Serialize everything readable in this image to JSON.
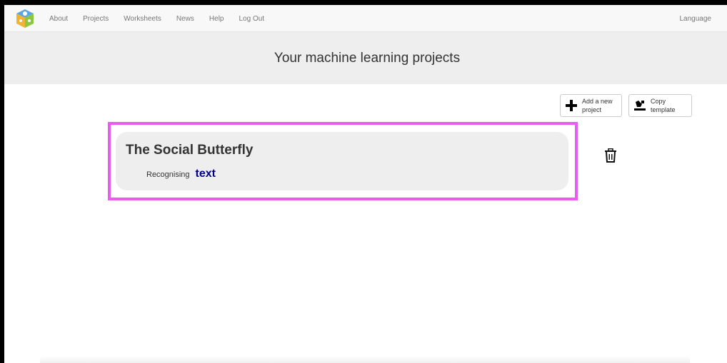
{
  "nav": {
    "links": [
      "About",
      "Projects",
      "Worksheets",
      "News",
      "Help",
      "Log Out"
    ],
    "language": "Language"
  },
  "header": {
    "title": "Your machine learning projects"
  },
  "actions": {
    "add_line1": "Add a new",
    "add_line2": "project",
    "copy_line1": "Copy",
    "copy_line2": "template"
  },
  "project": {
    "name": "The Social Butterfly",
    "type_label": "Recognising",
    "type_value": "text"
  },
  "colors": {
    "highlight": "#e85cf0",
    "type_value": "#00008b",
    "header_band": "#eeeeee"
  },
  "icons": {
    "logo": "ml4k-cube-logo",
    "add": "plus-icon",
    "copy": "copy-template-icon",
    "delete": "trash-icon"
  }
}
